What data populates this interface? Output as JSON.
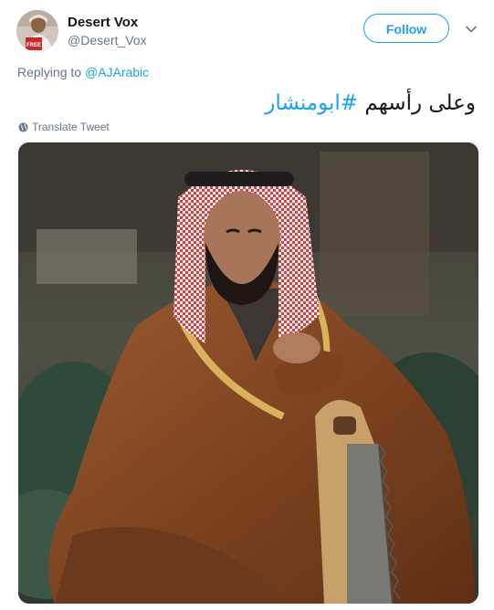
{
  "tweet": {
    "author": {
      "display_name": "Desert Vox",
      "handle": "@Desert_Vox",
      "avatar_sign_text": "FREE"
    },
    "follow_label": "Follow",
    "replying_prefix": "Replying to",
    "replying_to": "@AJArabic",
    "text_main": "وعلى رأسهم ",
    "hashtag": "#ابومنشار",
    "translate_label": "Translate Tweet"
  },
  "colors": {
    "accent": "#1da1f2",
    "text": "#14171a",
    "secondary": "#657786"
  },
  "icons": {
    "more": "chevron-down-icon",
    "translate": "globe-icon"
  }
}
